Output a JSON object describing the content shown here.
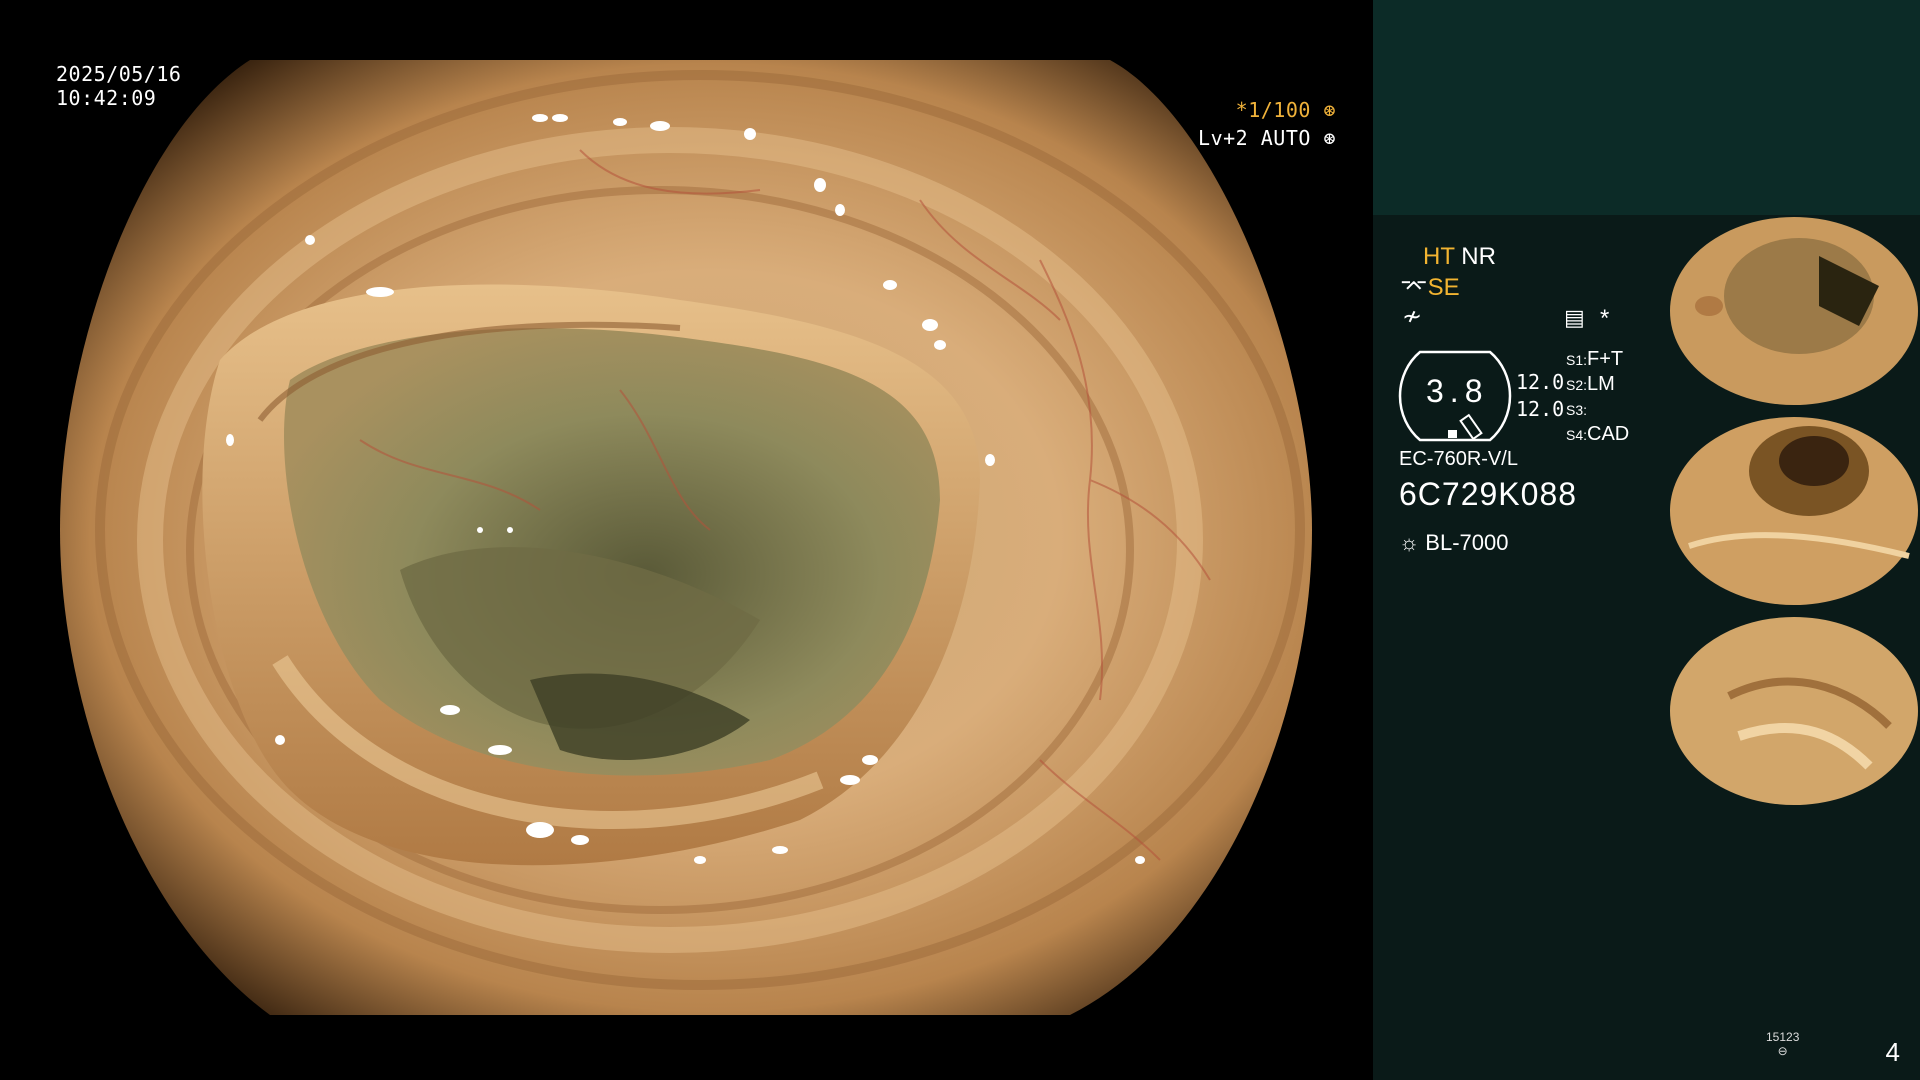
{
  "osd": {
    "date": "2025/05/16",
    "time": "10:42:09",
    "shutter": "*1/100",
    "level": "Lv+2 AUTO"
  },
  "panel": {
    "ht_label": "HT",
    "nr_label": "NR",
    "se_label": "SE",
    "gauge_value": "3.8",
    "val_a": "12.0",
    "val_b": "12.0",
    "s1": "S1:",
    "s1_val": "F+T",
    "s2": "S2:",
    "s2_val": "LM",
    "s3": "S3:",
    "s3_val": "",
    "s4": "S4:",
    "s4_val": "CAD",
    "scope_model": "EC-760R-V/L",
    "serial": "6C729K088",
    "light_source": "BL-7000"
  },
  "footer": {
    "disk_count": "15123",
    "image_index": "4"
  },
  "colors": {
    "accent_yellow": "#f2b431",
    "panel_bg": "#0a1a18",
    "panel_top_bg": "#0c2b27"
  },
  "icons": [
    "aperture-icon",
    "iris-icon",
    "enhance-icon",
    "freeze-icon",
    "structure-icon",
    "star-icon",
    "light-source-icon",
    "disk-icon"
  ]
}
